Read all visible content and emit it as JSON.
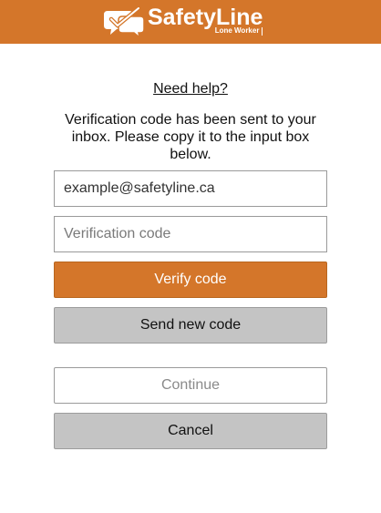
{
  "header": {
    "brand_name": "SafetyLine",
    "brand_subtitle": "Lone Worker",
    "logo_icon": "chat-bubbles-checkmark-icon",
    "background_color": "#d4762a"
  },
  "help": {
    "link_text": "Need help?"
  },
  "message": "Verification code has been sent to your inbox. Please copy it to the input box below.",
  "form": {
    "email_value": "example@safetyline.ca",
    "code_placeholder": "Verification code"
  },
  "buttons": {
    "verify_label": "Verify code",
    "send_new_label": "Send new code",
    "continue_label": "Continue",
    "cancel_label": "Cancel"
  },
  "colors": {
    "accent": "#d4762a",
    "secondary_button": "#c4c4c4"
  }
}
